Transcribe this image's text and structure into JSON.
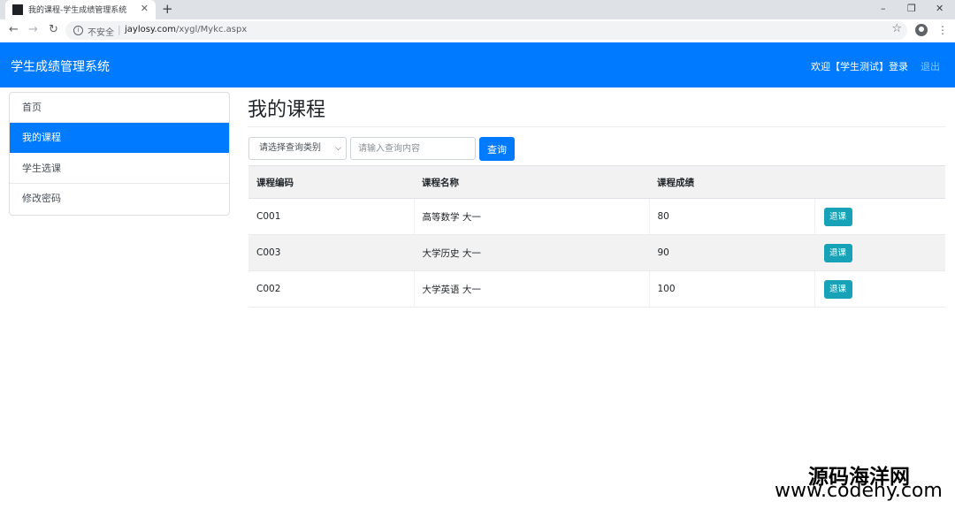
{
  "browser": {
    "tab_title": "我的课程-学生成绩管理系统",
    "tab_close": "✕",
    "new_tab": "+",
    "security_label": "不安全",
    "url_host": "jaylosy.com",
    "url_path": "/xygl/Mykc.aspx",
    "controls": {
      "minimize": "–",
      "restore": "❐",
      "close": "✕"
    },
    "icons": [
      "back-arrow-icon",
      "forward-arrow-icon",
      "reload-icon",
      "info-icon",
      "star-icon",
      "account-icon",
      "menu-icon"
    ]
  },
  "navbar": {
    "brand": "学生成绩管理系统",
    "welcome": "欢迎【学生测试】登录",
    "logout": "退出",
    "color": "#007bff"
  },
  "sidebar": {
    "items": [
      {
        "label": "首页",
        "active": false
      },
      {
        "label": "我的课程",
        "active": true
      },
      {
        "label": "学生选课",
        "active": false
      },
      {
        "label": "修改密码",
        "active": false
      }
    ]
  },
  "main": {
    "title": "我的课程",
    "search": {
      "select_value": "请选择查询类别",
      "placeholder": "请输入查询内容",
      "button_label": "查询"
    },
    "table": {
      "headers": [
        "课程编码",
        "课程名称",
        "课程成绩",
        ""
      ],
      "rows": [
        {
          "code": "C001",
          "name": "高等数学 大一",
          "score": "80",
          "action": "退课"
        },
        {
          "code": "C003",
          "name": "大学历史 大一",
          "score": "90",
          "action": "退课"
        },
        {
          "code": "C002",
          "name": "大学英语 大一",
          "score": "100",
          "action": "退课"
        }
      ]
    },
    "action_color": "#17a2b8"
  },
  "watermark": {
    "line1": "源码海洋网",
    "line2": "www.codehy.com"
  }
}
